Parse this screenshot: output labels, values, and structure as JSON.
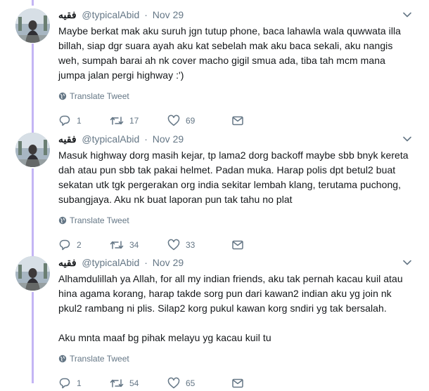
{
  "tweets": [
    {
      "name": "فقيه",
      "handle": "@typicalAbid",
      "date": "Nov 29",
      "text": "Maybe berkat mak aku suruh jgn tutup phone, baca lahawla wala quwwata illa billah, siap dgr suara ayah aku kat sebelah mak aku baca sekali, aku nangis weh, sumpah barai ah nk cover macho gigil smua ada, tiba tah mcm mana jumpa jalan pergi highway :')",
      "translate": "Translate Tweet",
      "replies": "1",
      "retweets": "17",
      "likes": "69"
    },
    {
      "name": "فقيه",
      "handle": "@typicalAbid",
      "date": "Nov 29",
      "text": "Masuk highway dorg masih kejar, tp lama2 dorg backoff maybe sbb bnyk kereta dah atau pun sbb tak pakai helmet. Padan muka. Harap polis dpt betul2 buat sekatan utk tgk pergerakan org india sekitar lembah klang, terutama puchong, subangjaya. Aku nk buat laporan pun tak tahu no plat",
      "translate": "Translate Tweet",
      "replies": "2",
      "retweets": "34",
      "likes": "33"
    },
    {
      "name": "فقيه",
      "handle": "@typicalAbid",
      "date": "Nov 29",
      "text": "Alhamdulillah ya Allah, for all my indian friends, aku tak pernah kacau kuil atau hina agama korang, harap takde sorg pun dari kawan2 indian aku yg join nk pkul2 rambang ni plis. Silap2 korg pukul kawan korg sndiri yg tak bersalah.\n\nAku mnta maaf bg pihak melayu yg kacau kuil tu",
      "translate": "Translate Tweet",
      "replies": "1",
      "retweets": "54",
      "likes": "65"
    }
  ],
  "colors": {
    "thread": "#c4b5f4",
    "muted": "#657786",
    "text": "#14171a"
  },
  "icons": [
    "avatar",
    "chevron-down-icon",
    "globe-icon",
    "reply-icon",
    "retweet-icon",
    "like-icon",
    "message-icon"
  ]
}
